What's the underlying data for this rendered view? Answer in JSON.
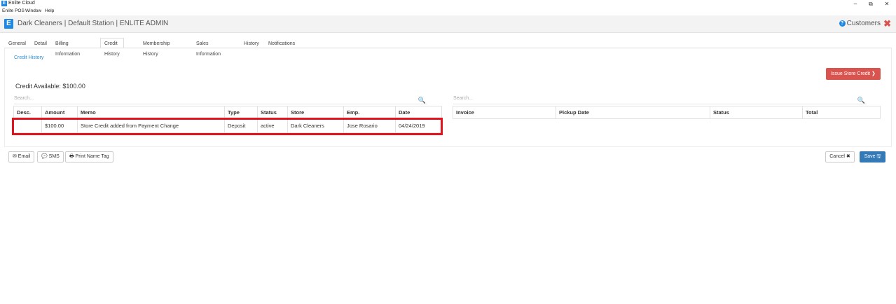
{
  "window": {
    "title": "Enlite Cloud",
    "menu": [
      "Enlite POS",
      "Window",
      "Help"
    ],
    "minimize": "–",
    "restore": "⧉",
    "close": "✕"
  },
  "header": {
    "logo": "E",
    "title": "Dark Cleaners | Default Station | ENLITE ADMIN",
    "section": "Customers",
    "help_icon": "?",
    "close_icon": "✖"
  },
  "tabs": [
    "General",
    "Detail",
    "Billing Information",
    "Credit History",
    "Membership History",
    "Sales Information",
    "History",
    "Notifications"
  ],
  "active_tab": "Credit History",
  "breadcrumb": "Credit History",
  "credit_available": "Credit Available: $100.00",
  "issue_button": "Issue Store Credit ❯",
  "left_search_placeholder": "Search...",
  "right_search_placeholder": "Search...",
  "search_icon": "🔍",
  "credit_table": {
    "columns": [
      "Desc.",
      "Amount",
      "Memo",
      "Type",
      "Status",
      "Store",
      "Emp.",
      "Date"
    ],
    "rows": [
      [
        "",
        "$100.00",
        "Store Credit added from Payment Change",
        "Deposit",
        "active",
        "Dark Cleaners",
        "Jose Rosario",
        "04/24/2019"
      ]
    ]
  },
  "invoice_table": {
    "columns": [
      "Invoice",
      "Pickup Date",
      "Status",
      "Total"
    ]
  },
  "footer": {
    "email": "✉ Email",
    "sms": "💬 SMS",
    "print": "🖶 Print Name Tag",
    "cancel": "Cancel ✖",
    "save": "Save 🖫"
  },
  "colors": {
    "accent": "#1e88e5",
    "danger": "#d9534f",
    "primary": "#337ab7",
    "highlight": "#e0141e"
  }
}
